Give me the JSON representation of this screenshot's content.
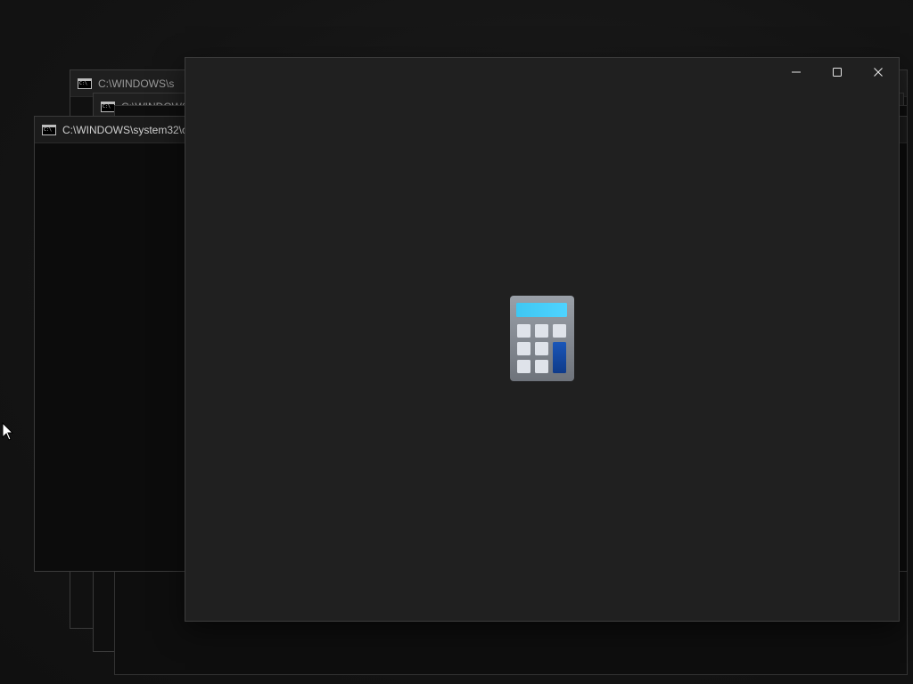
{
  "windows": {
    "console_title_main": "C:\\WINDOWS\\system32\\c",
    "console_title_back_1": "C:\\WINDOWS\\s",
    "console_title_back_2": "C:\\WINDOWS\\"
  },
  "calculator": {
    "icon": "calculator-icon",
    "caption_buttons": {
      "minimize": "minimize-icon",
      "maximize": "maximize-icon",
      "close": "close-icon"
    }
  },
  "colors": {
    "calc_bg": "#202020",
    "calc_display": "#3fc7f2",
    "calc_accent_key": "#0f3b8a"
  }
}
